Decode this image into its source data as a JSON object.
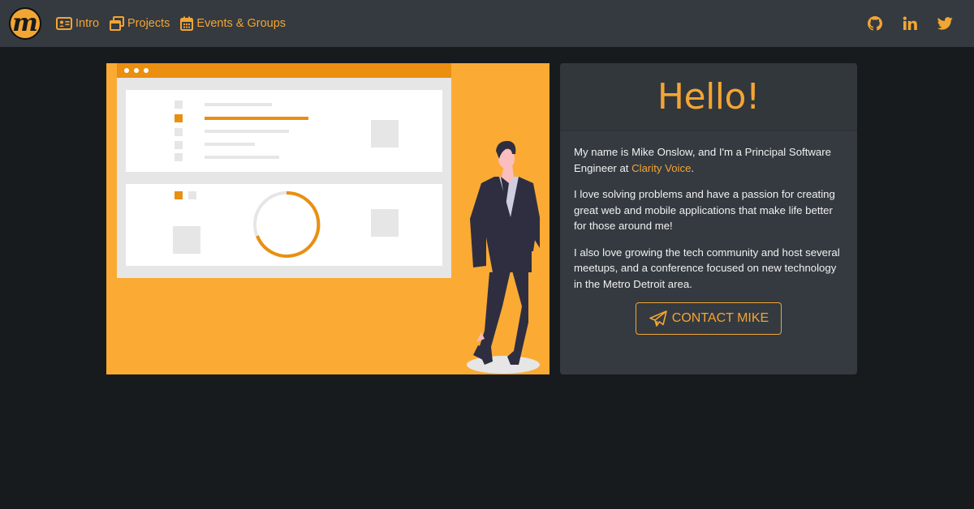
{
  "nav": {
    "logo_letter": "m",
    "links": [
      {
        "label": "Intro",
        "icon": "id-card-icon"
      },
      {
        "label": "Projects",
        "icon": "windows-icon"
      },
      {
        "label": "Events & Groups",
        "icon": "calendar-icon"
      }
    ],
    "social": [
      "github-icon",
      "linkedin-icon",
      "twitter-icon"
    ]
  },
  "card": {
    "title": "Hello!",
    "p1_before": "My name is Mike Onslow, and I'm a Principal Software Engineer at ",
    "p1_link": "Clarity Voice",
    "p1_after": ".",
    "p2": "I love solving problems and have a passion for creating great web and mobile applications that make life better for those around me!",
    "p3": "I also love growing the tech community and host several meetups, and a conference focused on new technology in the Metro Detroit area.",
    "button": "CONTACT MIKE"
  },
  "colors": {
    "accent": "#f3a533",
    "background": "#181b1e",
    "navbar": "#343a40",
    "illustration_bg": "#fbab34"
  }
}
